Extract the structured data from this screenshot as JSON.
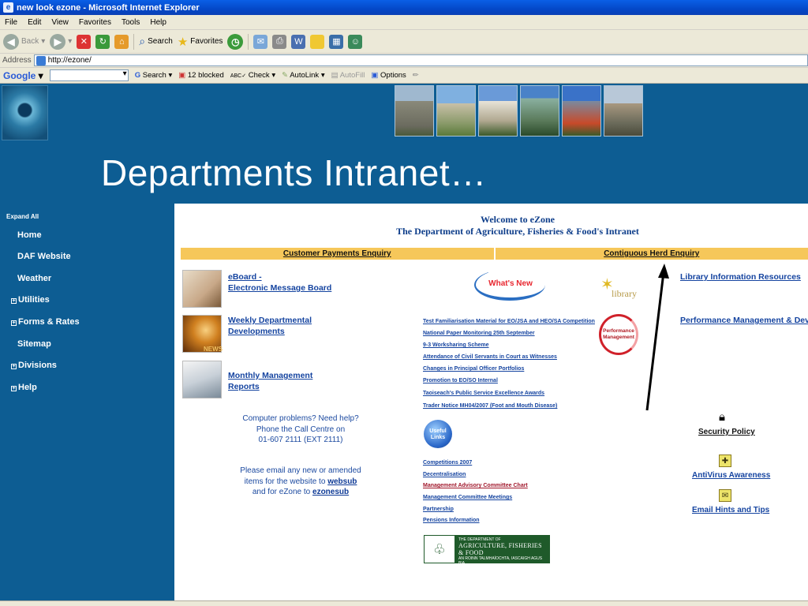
{
  "window": {
    "title": "new look ezone - Microsoft Internet Explorer"
  },
  "menubar": [
    "File",
    "Edit",
    "View",
    "Favorites",
    "Tools",
    "Help"
  ],
  "toolbar": {
    "back": "Back",
    "search": "Search",
    "favorites": "Favorites"
  },
  "address": {
    "label": "Address",
    "url": "http://ezone/"
  },
  "googlebar": {
    "logo": "Google",
    "search": "Search",
    "blocked": "12 blocked",
    "check": "Check",
    "autolink": "AutoLink",
    "autofill": "AutoFill",
    "options": "Options"
  },
  "slide": {
    "title": "Departments Intranet…"
  },
  "sidebar": {
    "expand_all": "Expand All",
    "items": [
      {
        "label": "Home",
        "expandable": false
      },
      {
        "label": "DAF Website",
        "expandable": false
      },
      {
        "label": "Weather",
        "expandable": false
      },
      {
        "label": "Utilities",
        "expandable": true
      },
      {
        "label": "Forms & Rates",
        "expandable": true
      },
      {
        "label": "Sitemap",
        "expandable": false
      },
      {
        "label": "Divisions",
        "expandable": true
      },
      {
        "label": "Help",
        "expandable": true
      }
    ]
  },
  "content": {
    "welcome_line1": "Welcome to eZone",
    "welcome_line2": "The Department of Agriculture, Fisheries & Food's Intranet",
    "enquiry_left": "Customer Payments  Enquiry",
    "enquiry_right": "Contiguous Herd Enquiry",
    "eboard_line1": "eBoard -",
    "eboard_line2": "Electronic Message Board",
    "weekly_line1": "Weekly Departmental",
    "weekly_line2": "Developments",
    "monthly_line1": "Monthly Management",
    "monthly_line2": "Reports",
    "thumb_news_label": "NEWS",
    "whats_new": "What's New",
    "news_links": [
      "Test Familiarisation Material for EO/JSA and HEO/SA Competition",
      "National Paper Monitoring 25th September",
      "9-3 Worksharing Scheme",
      "Attendance of Civil Servants in Court as Witnesses",
      "Changes in Principal Officer Portfolios",
      "Promotion to EO/SO Internal",
      "Taoiseach's Public Service Excellence Awards",
      "Trader Notice MH04/2007 (Foot and Mouth Disease)"
    ],
    "useful_links_line1": "Useful",
    "useful_links_line2": "Links",
    "useful_links": [
      "Competitions 2007",
      "Decentralisation",
      "Management Advisory Committee Chart",
      "Management Committee Meetings",
      "Partnership",
      "Pensions Information"
    ],
    "help_line1": "Computer problems?  Need help?",
    "help_line2": "Phone the Call Centre on",
    "help_line3": "01-607 2111 (EXT 2111)",
    "email_line1": "Please email any new or amended",
    "email_line2": "items for the website to",
    "email_websub": "websub",
    "email_line3": "and for eZone to",
    "email_ezonesub": "ezonesub",
    "library_link": "Library Information Resources",
    "library_logo_word": "library",
    "performance_logo_line1": "Performance",
    "performance_logo_line2": "Management",
    "performance_link": "Performance Management & Developm",
    "security_policy": "Security Policy",
    "antivirus": "AntiVirus Awareness",
    "email_hints": "Email Hints and Tips",
    "dept_logo_small": "THE DEPARTMENT OF",
    "dept_logo_big": "AGRICULTURE, FISHERIES & FOOD",
    "dept_logo_irish": "AN ROINN TALMHAÍOCHTA, IASCAIGH AGUS BIA"
  },
  "colors": {
    "slide_bg": "#0d5d93",
    "enquiry_bar": "#f6c75a",
    "link": "#1544a0"
  }
}
